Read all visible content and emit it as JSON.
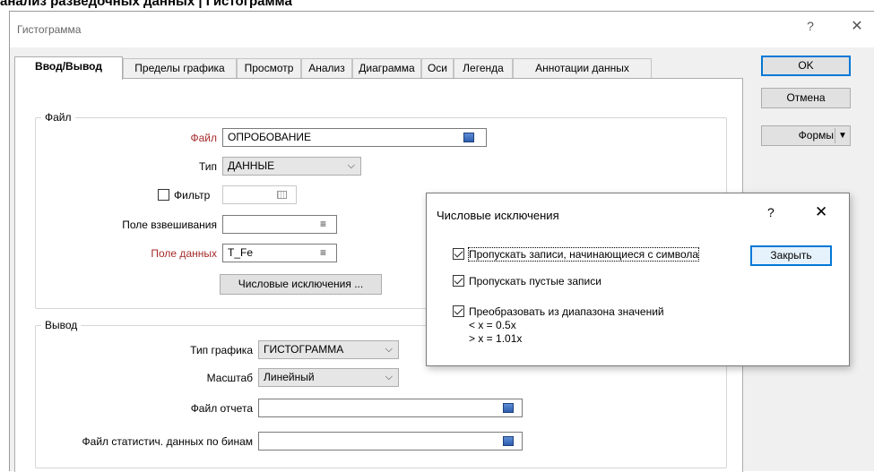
{
  "page_heading": "анализ разведочных данных | Гистограмма",
  "window": {
    "title": "Гистограмма",
    "help_glyph": "?",
    "close_glyph": "✕"
  },
  "tabs": [
    {
      "label": "Ввод/Вывод",
      "active": true
    },
    {
      "label": "Пределы графика"
    },
    {
      "label": "Просмотр"
    },
    {
      "label": "Анализ"
    },
    {
      "label": "Диаграмма"
    },
    {
      "label": "Оси"
    },
    {
      "label": "Легенда"
    },
    {
      "label": "Аннотации данных"
    }
  ],
  "file_group": {
    "title": "Файл",
    "file_label": "Файл",
    "file_value": "ОПРОБОВАНИЕ",
    "type_label": "Тип",
    "type_value": "ДАННЫЕ",
    "filter_label": "Фильтр",
    "filter_checked": false,
    "filter_value": "",
    "weight_label": "Поле взвешивания",
    "weight_value": "",
    "data_field_label": "Поле данных",
    "data_field_value": "T_Fe",
    "numeric_exceptions_button": "Числовые исключения ..."
  },
  "output_group": {
    "title": "Вывод",
    "chart_type_label": "Тип графика",
    "chart_type_value": "ГИСТОГРАММА",
    "scale_label": "Масштаб",
    "scale_value": "Линейный",
    "report_file_label": "Файл отчета",
    "report_file_value": "",
    "bin_stats_label": "Файл статистич. данных по бинам",
    "bin_stats_value": ""
  },
  "side_buttons": {
    "ok": "OK",
    "cancel": "Отмена",
    "forms": "Формы",
    "forms_arrow": "▼"
  },
  "dialog": {
    "title": "Числовые исключения",
    "help_glyph": "?",
    "close_glyph": "✕",
    "opt1_label": "Пропускать записи, начинающиеся с символа",
    "opt1_checked": true,
    "opt2_label": "Пропускать пустые записи",
    "opt2_checked": true,
    "opt3_label": "Преобразовать из диапазона значений",
    "opt3_checked": true,
    "rule_lt": "< x = 0.5x",
    "rule_gt": "> x = 1.01x",
    "close_button": "Закрыть"
  },
  "icons": {
    "file_browse": "square-file-icon",
    "combo": "chevron-down-icon",
    "list": "list-icon",
    "grid": "grid-icon"
  },
  "colors": {
    "required_label": "#a52a2a",
    "accent": "#0078d7"
  }
}
